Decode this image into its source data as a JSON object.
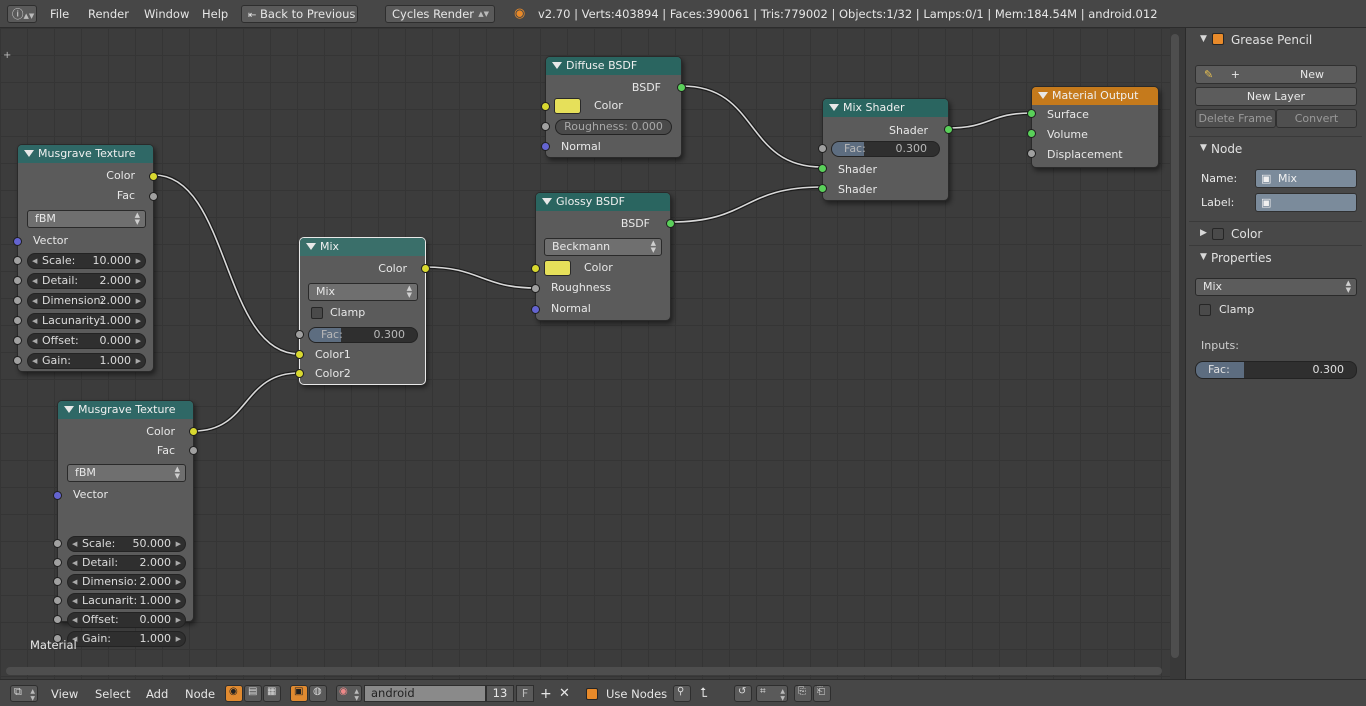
{
  "header": {
    "menus": [
      "File",
      "Render",
      "Window",
      "Help"
    ],
    "back_label": "Back to Previous",
    "engine": "Cycles Render",
    "stats": "v2.70 | Verts:403894 | Faces:390061 | Tris:779002 | Objects:1/32 | Lamps:0/1 | Mem:184.54M | android.012"
  },
  "canvas": {
    "label": "Material"
  },
  "nodes": {
    "musgrave1": {
      "title": "Musgrave Texture",
      "out_color": "Color",
      "out_fac": "Fac",
      "mode": "fBM",
      "vector": "Vector",
      "fields": [
        {
          "label": "Scale:",
          "value": "10.000"
        },
        {
          "label": "Detail:",
          "value": "2.000"
        },
        {
          "label": "Dimension:",
          "value": "2.000"
        },
        {
          "label": "Lacunarity:",
          "value": "1.000"
        },
        {
          "label": "Offset:",
          "value": "0.000"
        },
        {
          "label": "Gain:",
          "value": "1.000"
        }
      ]
    },
    "musgrave2": {
      "title": "Musgrave Texture",
      "out_color": "Color",
      "out_fac": "Fac",
      "mode": "fBM",
      "vector": "Vector",
      "fields": [
        {
          "label": "Scale:",
          "value": "50.000"
        },
        {
          "label": "Detail:",
          "value": "2.000"
        },
        {
          "label": "Dimensio:",
          "value": "2.000"
        },
        {
          "label": "Lacunarit:",
          "value": "1.000"
        },
        {
          "label": "Offset:",
          "value": "0.000"
        },
        {
          "label": "Gain:",
          "value": "1.000"
        }
      ]
    },
    "mix": {
      "title": "Mix",
      "out_color": "Color",
      "mode": "Mix",
      "clamp": "Clamp",
      "fac_label": "Fac:",
      "fac_value": "0.300",
      "fac": 0.3,
      "color1": "Color1",
      "color2": "Color2"
    },
    "diffuse": {
      "title": "Diffuse BSDF",
      "out": "BSDF",
      "color": "Color",
      "roughness": "Roughness: 0.000",
      "normal": "Normal",
      "swatch": "#e6e05a"
    },
    "glossy": {
      "title": "Glossy BSDF",
      "out": "BSDF",
      "mode": "Beckmann",
      "color": "Color",
      "roughness": "Roughness",
      "normal": "Normal",
      "swatch": "#e6e05a"
    },
    "mixshader": {
      "title": "Mix Shader",
      "out": "Shader",
      "fac_label": "Fac:",
      "fac_value": "0.300",
      "fac": 0.3,
      "in1": "Shader",
      "in2": "Shader"
    },
    "output": {
      "title": "Material Output",
      "surface": "Surface",
      "volume": "Volume",
      "displacement": "Displacement"
    }
  },
  "sidebar": {
    "grease_pencil": "Grease Pencil",
    "new_label": "New",
    "new_layer": "New Layer",
    "delete_frame": "Delete Frame",
    "convert": "Convert",
    "node_header": "Node",
    "name_label": "Name:",
    "name_value": "Mix",
    "label_label": "Label:",
    "label_value": "",
    "color_header": "Color",
    "properties_header": "Properties",
    "mode": "Mix",
    "clamp": "Clamp",
    "inputs_label": "Inputs:",
    "fac_label": "Fac:",
    "fac_value": "0.300",
    "fac": 0.3
  },
  "footer": {
    "menus": [
      "View",
      "Select",
      "Add",
      "Node"
    ],
    "material_name": "android",
    "users": "13",
    "fake_user": "F",
    "use_nodes": "Use Nodes"
  }
}
